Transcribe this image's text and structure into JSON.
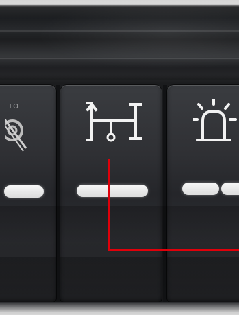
{
  "scene": {
    "description_tags": [
      "vehicle-dashboard",
      "switch-panel",
      "close-up"
    ],
    "colors": {
      "button_body": "#2f3034",
      "icon_white": "#f2f2f2",
      "led_white": "#efefef",
      "callout_red": "#e0000a",
      "panel_dark": "#15171a"
    }
  },
  "buttons": {
    "left": {
      "icon": "auto-off-icon",
      "icon_text": "TO"
    },
    "middle": {
      "icon": "differential-lock-icon"
    },
    "right": {
      "icon": "beacon-light-icon"
    }
  },
  "annotation": {
    "type": "callout-line",
    "color": "#e0000a",
    "points_to": "middle-button-icon"
  }
}
